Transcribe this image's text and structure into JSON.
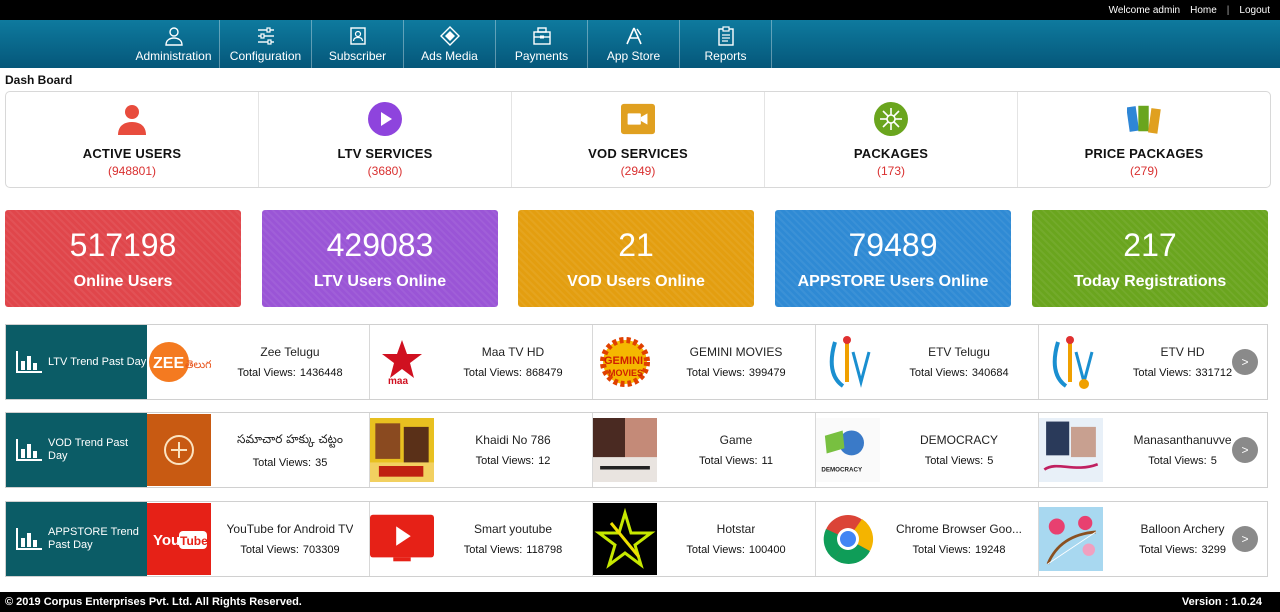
{
  "topbar": {
    "welcome": "Welcome admin",
    "home": "Home",
    "sep": "|",
    "logout": "Logout"
  },
  "nav": [
    {
      "label": "Administration",
      "icon": "user-icon"
    },
    {
      "label": "Configuration",
      "icon": "sliders-icon"
    },
    {
      "label": "Subscriber",
      "icon": "subscriber-icon"
    },
    {
      "label": "Ads Media",
      "icon": "ads-icon"
    },
    {
      "label": "Payments",
      "icon": "payments-icon"
    },
    {
      "label": "App Store",
      "icon": "appstore-icon"
    },
    {
      "label": "Reports",
      "icon": "reports-icon"
    }
  ],
  "dashboard_title": "Dash Board",
  "summary": [
    {
      "label": "ACTIVE USERS",
      "count": "(948801)",
      "icon": "person-icon",
      "color": "#e84c3d"
    },
    {
      "label": "LTV SERVICES",
      "count": "(3680)",
      "icon": "play-icon",
      "color": "#8e44dd"
    },
    {
      "label": "VOD SERVICES",
      "count": "(2949)",
      "icon": "video-camera-icon",
      "color": "#e0a020"
    },
    {
      "label": "PACKAGES",
      "count": "(173)",
      "icon": "packages-icon",
      "color": "#6aa51e"
    },
    {
      "label": "PRICE PACKAGES",
      "count": "(279)",
      "icon": "price-cards-icon",
      "color": "#2e86d6"
    }
  ],
  "tiles": [
    {
      "value": "517198",
      "label": "Online Users",
      "color": "#e0464b"
    },
    {
      "value": "429083",
      "label": "LTV Users Online",
      "color": "#9a55d6"
    },
    {
      "value": "21",
      "label": "VOD Users Online",
      "color": "#e39e10"
    },
    {
      "value": "79489",
      "label": "APPSTORE Users Online",
      "color": "#2f8ad4"
    },
    {
      "value": "217",
      "label": "Today Registrations",
      "color": "#6aa51e"
    }
  ],
  "views_label": "Total Views:",
  "trends": [
    {
      "title": "LTV Trend Past Day",
      "items": [
        {
          "name": "Zee Telugu",
          "views": "1436448"
        },
        {
          "name": "Maa TV HD",
          "views": "868479"
        },
        {
          "name": "GEMINI MOVIES",
          "views": "399479"
        },
        {
          "name": "ETV Telugu",
          "views": "340684"
        },
        {
          "name": "ETV HD",
          "views": "331712"
        }
      ]
    },
    {
      "title": "VOD Trend Past Day",
      "items": [
        {
          "name": "సమాచార హక్కు చట్టం",
          "views": "35"
        },
        {
          "name": "Khaidi No 786",
          "views": "12"
        },
        {
          "name": "Game",
          "views": "11"
        },
        {
          "name": "DEMOCRACY",
          "views": "5"
        },
        {
          "name": "Manasanthanuvve",
          "views": "5"
        }
      ]
    },
    {
      "title": "APPSTORE Trend Past Day",
      "items": [
        {
          "name": "YouTube for Android TV",
          "views": "703309"
        },
        {
          "name": "Smart youtube",
          "views": "118798"
        },
        {
          "name": "Hotstar",
          "views": "100400"
        },
        {
          "name": "Chrome Browser Goo...",
          "views": "19248"
        },
        {
          "name": "Balloon Archery",
          "views": "3299"
        }
      ]
    }
  ],
  "thumb_text": {
    "zee": "ZEE",
    "zee_telugu": "తెలుగు",
    "maa": "maa",
    "gemini": "GEMINI",
    "gemini_sub": "MOVIES",
    "democracy": "DEMOCRACY",
    "youtube_you": "You",
    "youtube_tube": "Tube"
  },
  "next_label": ">",
  "footer": {
    "copyright": "© 2019 Corpus Enterprises Pvt. Ltd. All Rights Reserved.",
    "version": "Version : 1.0.24"
  }
}
